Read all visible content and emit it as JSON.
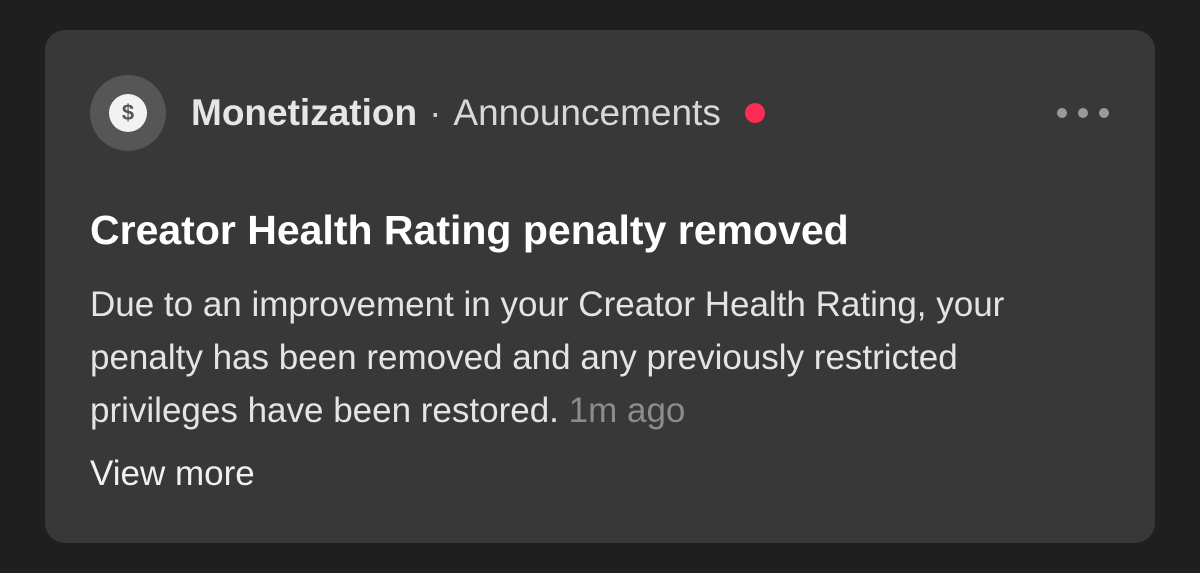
{
  "notification": {
    "icon": "dollar-icon",
    "icon_glyph": "$",
    "source": "Monetization",
    "separator": "·",
    "category": "Announcements",
    "unread_dot_color": "#fe2c55",
    "title": "Creator Health Rating penalty removed",
    "body": "Due to an improvement in your Creator Health Rating, your penalty has been removed and any previously restricted privileges have been restored.",
    "timestamp": "1m ago",
    "view_more_label": "View more"
  }
}
